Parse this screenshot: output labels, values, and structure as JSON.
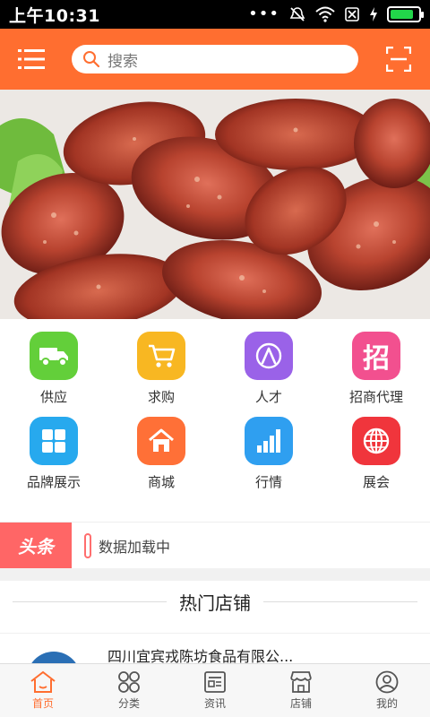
{
  "status_bar": {
    "time": "上午10:31",
    "battery_level": 0.85
  },
  "header": {
    "search_placeholder": "搜索"
  },
  "colors": {
    "brand": "#ff6e30",
    "headline_badge": "#ff6666"
  },
  "grid": [
    {
      "label": "供应",
      "icon": "truck-icon",
      "color": "#63cf3a"
    },
    {
      "label": "求购",
      "icon": "cart-icon",
      "color": "#f8b722"
    },
    {
      "label": "人才",
      "icon": "person-icon",
      "color": "#9a62e8"
    },
    {
      "label": "招商代理",
      "icon": "zhao-icon",
      "glyph": "招",
      "color": "#f2508f"
    },
    {
      "label": "品牌展示",
      "icon": "grid-icon",
      "color": "#27a9ee"
    },
    {
      "label": "商城",
      "icon": "home-icon",
      "color": "#ff7037"
    },
    {
      "label": "行情",
      "icon": "bar-chart-icon",
      "color": "#2f9ff0"
    },
    {
      "label": "展会",
      "icon": "globe-icon",
      "color": "#f0353c"
    }
  ],
  "headline": {
    "badge": "头条",
    "text": "数据加载中"
  },
  "hot_stores": {
    "title": "热门店铺",
    "items": [
      {
        "name": "四川宜宾戎陈坊食品有限公..."
      }
    ]
  },
  "bottom_nav": [
    {
      "label": "首页",
      "icon": "home-icon",
      "active": true
    },
    {
      "label": "分类",
      "icon": "category-icon",
      "active": false
    },
    {
      "label": "资讯",
      "icon": "news-icon",
      "active": false
    },
    {
      "label": "店铺",
      "icon": "store-icon",
      "active": false
    },
    {
      "label": "我的",
      "icon": "user-icon",
      "active": false
    }
  ]
}
